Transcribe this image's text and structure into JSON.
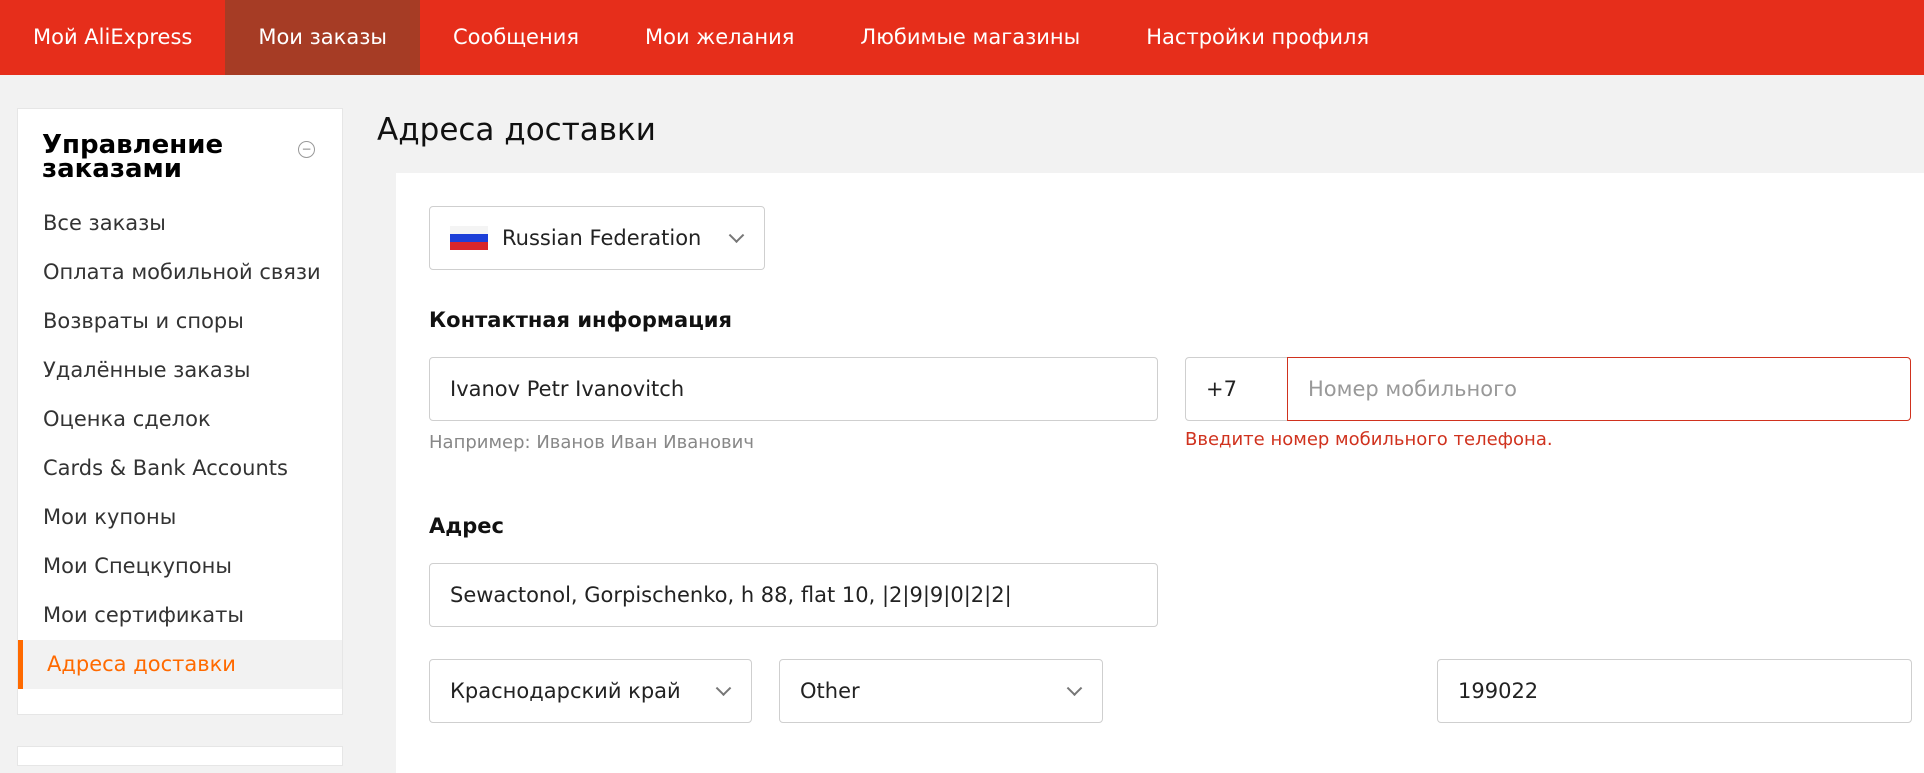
{
  "topnav": {
    "items": [
      {
        "label": "Мой AliExpress",
        "active": false
      },
      {
        "label": "Мои заказы",
        "active": true
      },
      {
        "label": "Сообщения",
        "active": false
      },
      {
        "label": "Мои желания",
        "active": false
      },
      {
        "label": "Любимые магазины",
        "active": false
      },
      {
        "label": "Настройки профиля",
        "active": false
      }
    ],
    "color": "#e62e1b",
    "active_color": "#a63c25"
  },
  "sidebar": {
    "title": "Управление заказами",
    "collapse_icon": "minus-circle-icon",
    "items": [
      {
        "label": "Все заказы"
      },
      {
        "label": "Оплата мобильной связи"
      },
      {
        "label": "Возвраты и споры"
      },
      {
        "label": "Удалённые заказы"
      },
      {
        "label": "Оценка сделок"
      },
      {
        "label": "Cards & Bank Accounts"
      },
      {
        "label": "Мои купоны"
      },
      {
        "label": "Мои Спецкупоны"
      },
      {
        "label": "Мои сертификаты"
      },
      {
        "label": "Адреса доставки",
        "active": true
      }
    ],
    "accent": "#ff6a00"
  },
  "main": {
    "title": "Адреса доставки",
    "country": {
      "value": "Russian Federation",
      "icon": "russia-flag-icon"
    },
    "contact": {
      "label": "Контактная информация",
      "name_value": "Ivanov Petr Ivanovitch",
      "name_hint": "Например: Иванов Иван Иванович",
      "phone_code": "+7",
      "phone_placeholder": "Номер мобильного",
      "phone_value": "",
      "phone_error": "Введите номер мобильного телефона."
    },
    "address": {
      "label": "Адрес",
      "street_value": "Sewactonol, Gorpischenko, h 88, flat 10, |2|9|9|0|2|2|",
      "region": "Краснодарский край",
      "city": "Other",
      "zip": "199022"
    },
    "error_color": "#d0321e"
  }
}
